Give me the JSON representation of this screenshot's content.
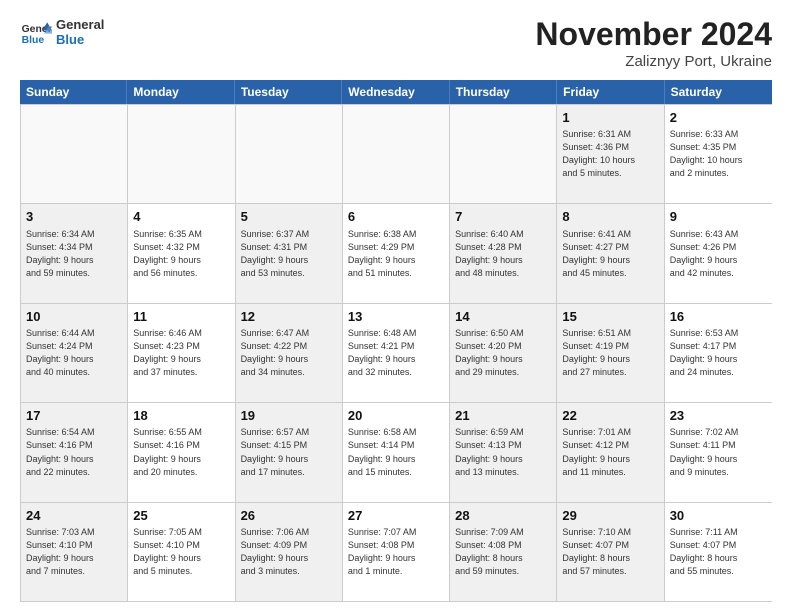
{
  "logo": {
    "line1": "General",
    "line2": "Blue"
  },
  "title": "November 2024",
  "subtitle": "Zaliznyy Port, Ukraine",
  "days": [
    "Sunday",
    "Monday",
    "Tuesday",
    "Wednesday",
    "Thursday",
    "Friday",
    "Saturday"
  ],
  "weeks": [
    [
      {
        "day": "",
        "info": "",
        "empty": true
      },
      {
        "day": "",
        "info": "",
        "empty": true
      },
      {
        "day": "",
        "info": "",
        "empty": true
      },
      {
        "day": "",
        "info": "",
        "empty": true
      },
      {
        "day": "",
        "info": "",
        "empty": true
      },
      {
        "day": "1",
        "info": "Sunrise: 6:31 AM\nSunset: 4:36 PM\nDaylight: 10 hours\nand 5 minutes.",
        "shaded": true
      },
      {
        "day": "2",
        "info": "Sunrise: 6:33 AM\nSunset: 4:35 PM\nDaylight: 10 hours\nand 2 minutes."
      }
    ],
    [
      {
        "day": "3",
        "info": "Sunrise: 6:34 AM\nSunset: 4:34 PM\nDaylight: 9 hours\nand 59 minutes.",
        "shaded": true
      },
      {
        "day": "4",
        "info": "Sunrise: 6:35 AM\nSunset: 4:32 PM\nDaylight: 9 hours\nand 56 minutes."
      },
      {
        "day": "5",
        "info": "Sunrise: 6:37 AM\nSunset: 4:31 PM\nDaylight: 9 hours\nand 53 minutes.",
        "shaded": true
      },
      {
        "day": "6",
        "info": "Sunrise: 6:38 AM\nSunset: 4:29 PM\nDaylight: 9 hours\nand 51 minutes."
      },
      {
        "day": "7",
        "info": "Sunrise: 6:40 AM\nSunset: 4:28 PM\nDaylight: 9 hours\nand 48 minutes.",
        "shaded": true
      },
      {
        "day": "8",
        "info": "Sunrise: 6:41 AM\nSunset: 4:27 PM\nDaylight: 9 hours\nand 45 minutes.",
        "shaded": true
      },
      {
        "day": "9",
        "info": "Sunrise: 6:43 AM\nSunset: 4:26 PM\nDaylight: 9 hours\nand 42 minutes."
      }
    ],
    [
      {
        "day": "10",
        "info": "Sunrise: 6:44 AM\nSunset: 4:24 PM\nDaylight: 9 hours\nand 40 minutes.",
        "shaded": true
      },
      {
        "day": "11",
        "info": "Sunrise: 6:46 AM\nSunset: 4:23 PM\nDaylight: 9 hours\nand 37 minutes."
      },
      {
        "day": "12",
        "info": "Sunrise: 6:47 AM\nSunset: 4:22 PM\nDaylight: 9 hours\nand 34 minutes.",
        "shaded": true
      },
      {
        "day": "13",
        "info": "Sunrise: 6:48 AM\nSunset: 4:21 PM\nDaylight: 9 hours\nand 32 minutes."
      },
      {
        "day": "14",
        "info": "Sunrise: 6:50 AM\nSunset: 4:20 PM\nDaylight: 9 hours\nand 29 minutes.",
        "shaded": true
      },
      {
        "day": "15",
        "info": "Sunrise: 6:51 AM\nSunset: 4:19 PM\nDaylight: 9 hours\nand 27 minutes.",
        "shaded": true
      },
      {
        "day": "16",
        "info": "Sunrise: 6:53 AM\nSunset: 4:17 PM\nDaylight: 9 hours\nand 24 minutes."
      }
    ],
    [
      {
        "day": "17",
        "info": "Sunrise: 6:54 AM\nSunset: 4:16 PM\nDaylight: 9 hours\nand 22 minutes.",
        "shaded": true
      },
      {
        "day": "18",
        "info": "Sunrise: 6:55 AM\nSunset: 4:16 PM\nDaylight: 9 hours\nand 20 minutes."
      },
      {
        "day": "19",
        "info": "Sunrise: 6:57 AM\nSunset: 4:15 PM\nDaylight: 9 hours\nand 17 minutes.",
        "shaded": true
      },
      {
        "day": "20",
        "info": "Sunrise: 6:58 AM\nSunset: 4:14 PM\nDaylight: 9 hours\nand 15 minutes."
      },
      {
        "day": "21",
        "info": "Sunrise: 6:59 AM\nSunset: 4:13 PM\nDaylight: 9 hours\nand 13 minutes.",
        "shaded": true
      },
      {
        "day": "22",
        "info": "Sunrise: 7:01 AM\nSunset: 4:12 PM\nDaylight: 9 hours\nand 11 minutes.",
        "shaded": true
      },
      {
        "day": "23",
        "info": "Sunrise: 7:02 AM\nSunset: 4:11 PM\nDaylight: 9 hours\nand 9 minutes."
      }
    ],
    [
      {
        "day": "24",
        "info": "Sunrise: 7:03 AM\nSunset: 4:10 PM\nDaylight: 9 hours\nand 7 minutes.",
        "shaded": true
      },
      {
        "day": "25",
        "info": "Sunrise: 7:05 AM\nSunset: 4:10 PM\nDaylight: 9 hours\nand 5 minutes."
      },
      {
        "day": "26",
        "info": "Sunrise: 7:06 AM\nSunset: 4:09 PM\nDaylight: 9 hours\nand 3 minutes.",
        "shaded": true
      },
      {
        "day": "27",
        "info": "Sunrise: 7:07 AM\nSunset: 4:08 PM\nDaylight: 9 hours\nand 1 minute."
      },
      {
        "day": "28",
        "info": "Sunrise: 7:09 AM\nSunset: 4:08 PM\nDaylight: 8 hours\nand 59 minutes.",
        "shaded": true
      },
      {
        "day": "29",
        "info": "Sunrise: 7:10 AM\nSunset: 4:07 PM\nDaylight: 8 hours\nand 57 minutes.",
        "shaded": true
      },
      {
        "day": "30",
        "info": "Sunrise: 7:11 AM\nSunset: 4:07 PM\nDaylight: 8 hours\nand 55 minutes."
      }
    ]
  ]
}
